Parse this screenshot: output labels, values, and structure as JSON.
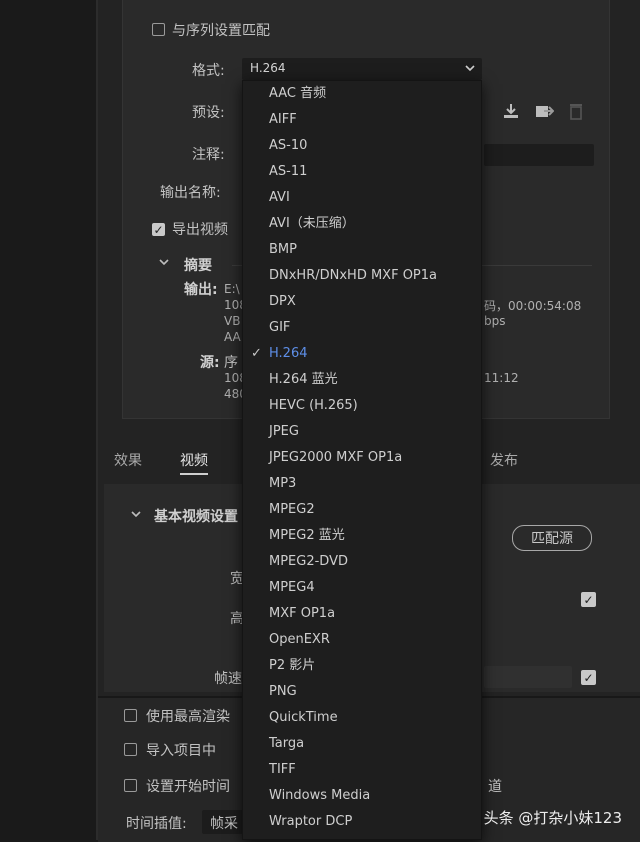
{
  "top": {
    "match_sequence_label": "与序列设置匹配",
    "format_label": "格式:",
    "format_value": "H.264",
    "preset_label": "预设:",
    "comment_label": "注释:",
    "output_name_label": "输出名称:",
    "export_video_label": "导出视频",
    "summary_label": "摘要",
    "output_label": "输出:",
    "output_lines": [
      "E:\\",
      "108",
      "VB",
      "AA"
    ],
    "output_trail_1": "码，00:00:54:08",
    "output_trail_2": "bps",
    "source_label": "源:",
    "source_lines": [
      "序",
      "108",
      "480"
    ],
    "source_trail": "11:12"
  },
  "tabs": {
    "effects": "效果",
    "video": "视频",
    "publish": "发布"
  },
  "video": {
    "basic_settings_label": "基本视频设置",
    "match_source_label": "匹配源",
    "width_label": "宽",
    "height_label": "高",
    "frame_rate_label": "帧速"
  },
  "bottom": {
    "max_render_label": "使用最高渲染",
    "import_project_label": "导入项目中",
    "set_start_time_label": "设置开始时间",
    "channel_fragment": "道",
    "interpolation_label": "时间插值:",
    "interpolation_value": "帧采"
  },
  "dropdown": {
    "selected": "H.264",
    "options": [
      "AAC 音频",
      "AIFF",
      "AS-10",
      "AS-11",
      "AVI",
      "AVI（未压缩）",
      "BMP",
      "DNxHR/DNxHD MXF OP1a",
      "DPX",
      "GIF",
      "H.264",
      "H.264 蓝光",
      "HEVC (H.265)",
      "JPEG",
      "JPEG2000 MXF OP1a",
      "MP3",
      "MPEG2",
      "MPEG2 蓝光",
      "MPEG2-DVD",
      "MPEG4",
      "MXF OP1a",
      "OpenEXR",
      "P2 影片",
      "PNG",
      "QuickTime",
      "Targa",
      "TIFF",
      "Windows Media",
      "Wraptor DCP"
    ]
  },
  "watermark": "头条 @打杂小妹123"
}
